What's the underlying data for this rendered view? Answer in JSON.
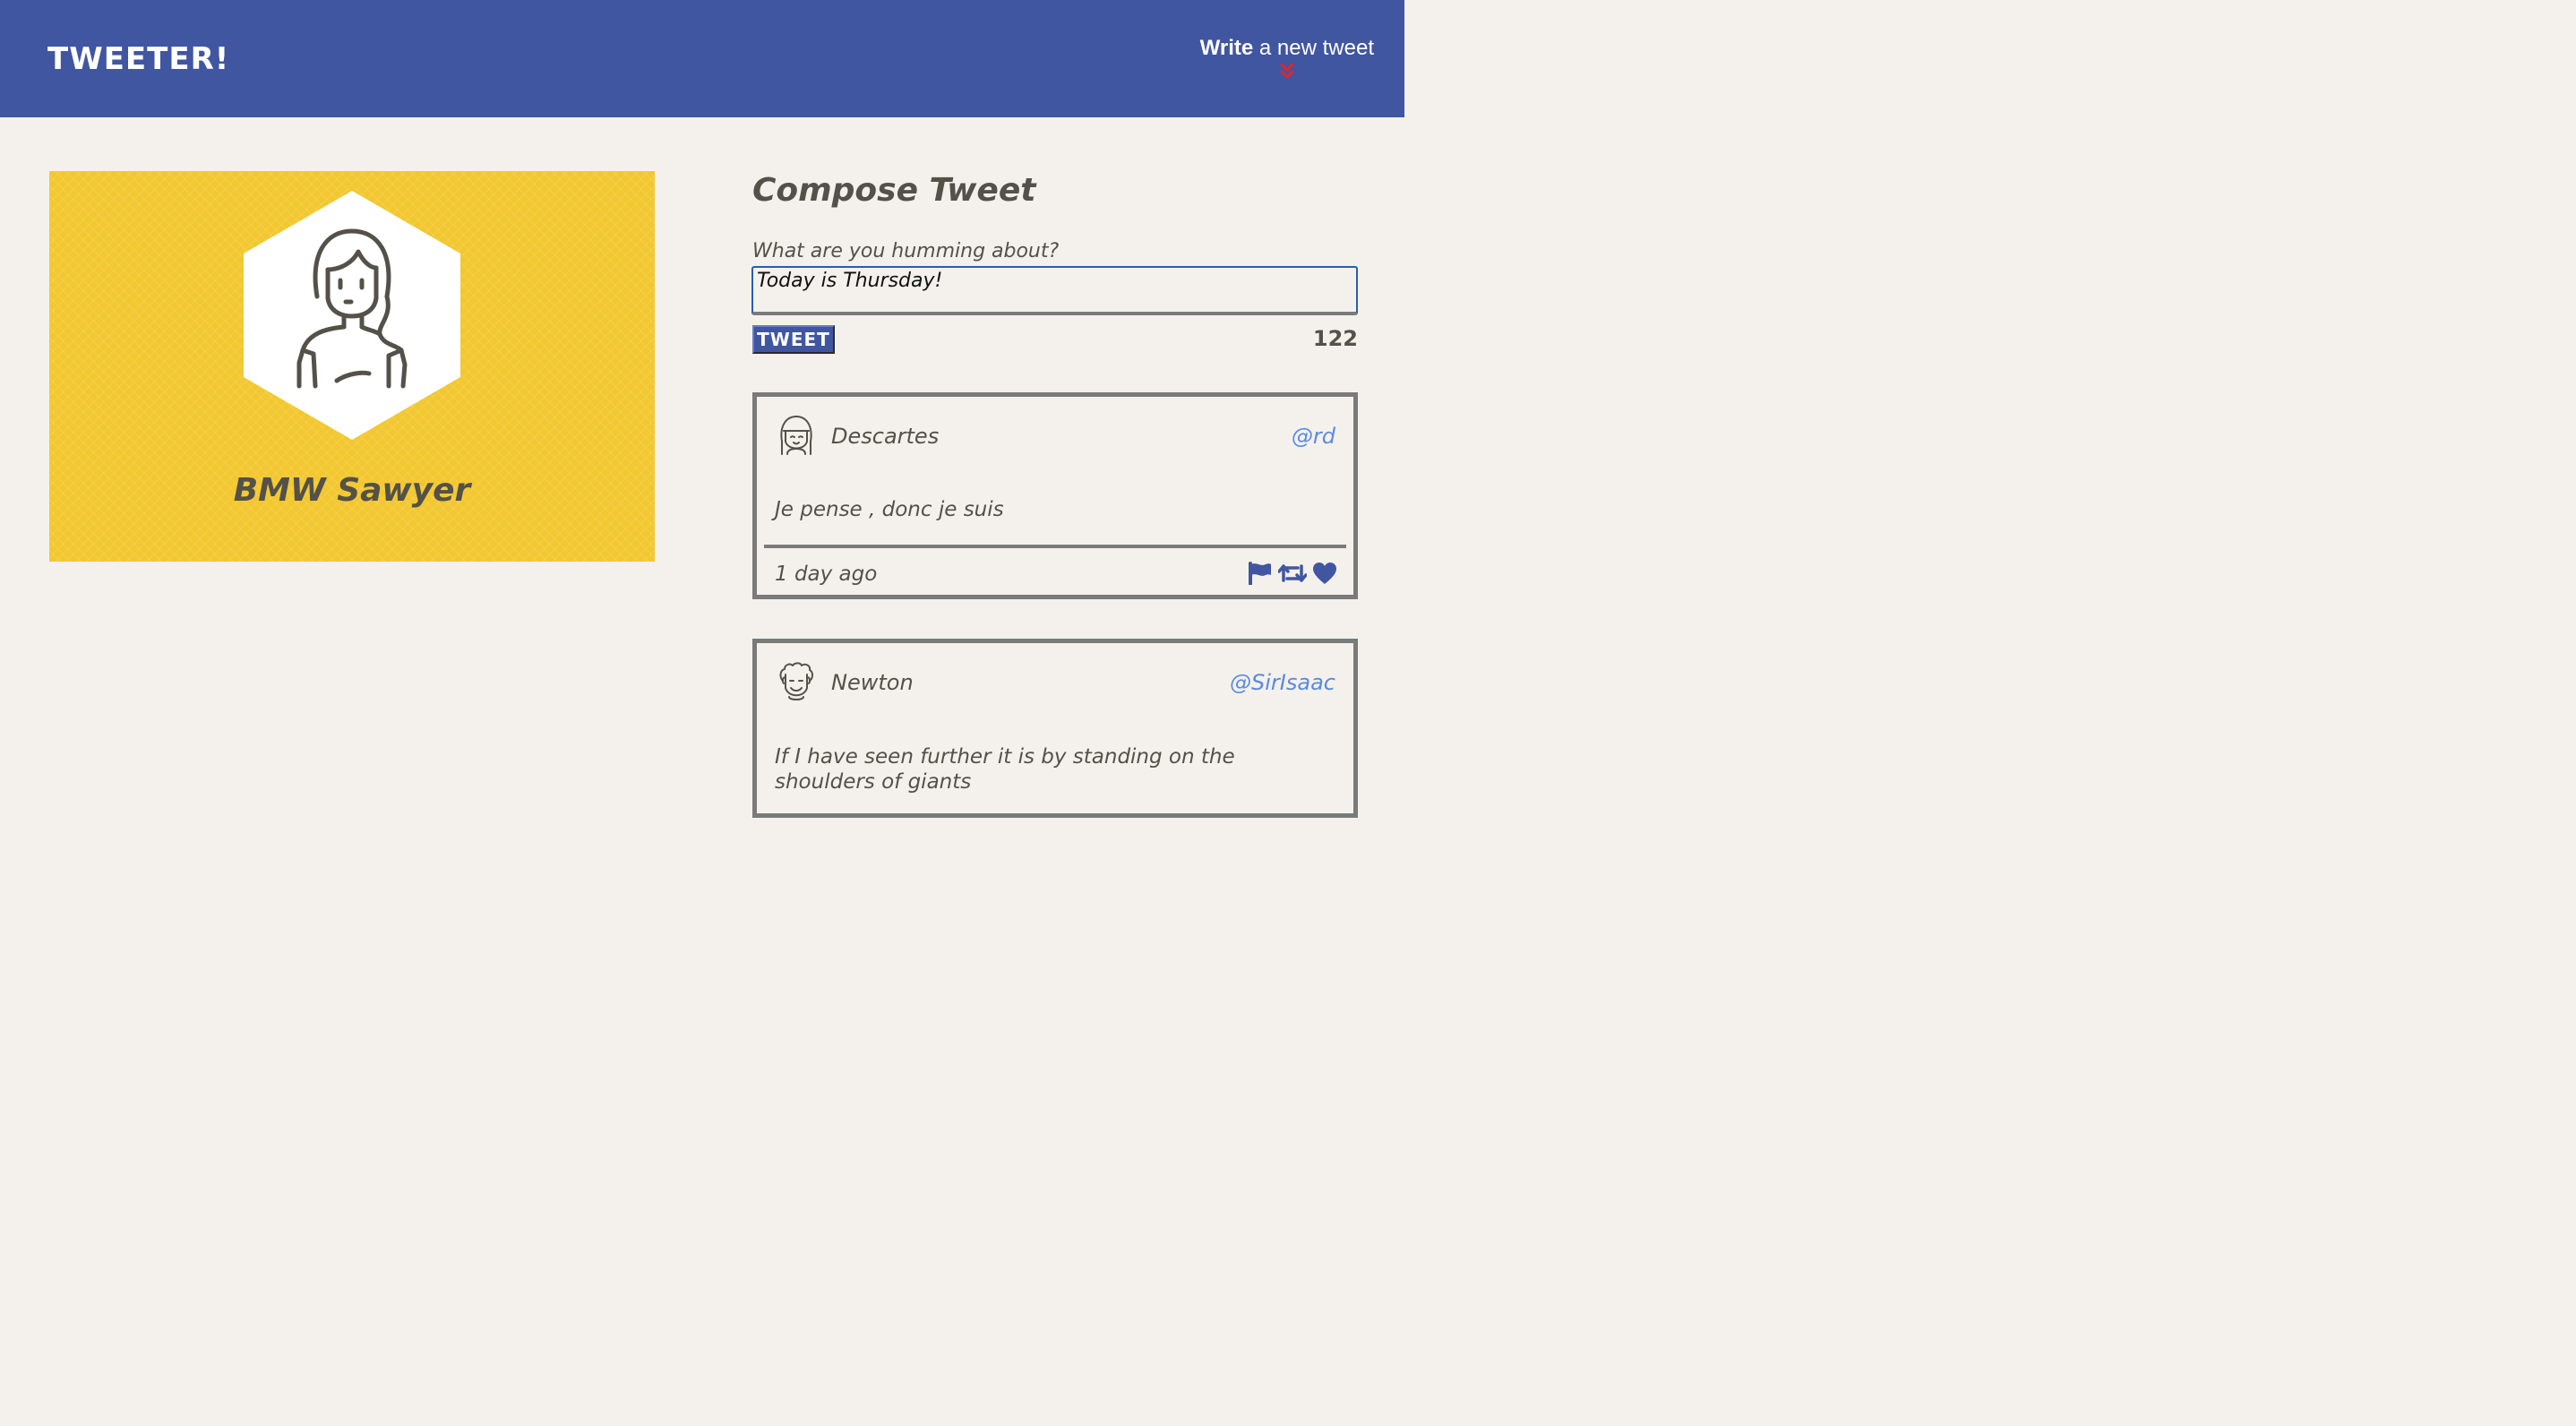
{
  "nav": {
    "brand": "TWEETER!",
    "compose_bold": "Write",
    "compose_rest": " a new tweet",
    "arrow_icon": "double-chevron-down-icon",
    "bg_color": "#4056a1",
    "arrow_color": "#e3242b"
  },
  "profile": {
    "name": "BMW Sawyer",
    "avatar_icon": "woman-avatar-icon",
    "bg_color": "#f2c72f"
  },
  "compose": {
    "title": "Compose Tweet",
    "label": "What are you humming about?",
    "value": "Today is Thursday!",
    "button_label": "TWEET",
    "counter": "122"
  },
  "tweets": [
    {
      "name": "Descartes",
      "handle": "@rd",
      "content": "Je pense , donc je suis",
      "time": "1 day ago",
      "avatar_icon": "girl-avatar-icon",
      "actions": [
        "flag-icon",
        "retweet-icon",
        "heart-icon"
      ]
    },
    {
      "name": "Newton",
      "handle": "@SirIsaac",
      "content": "If I have seen further it is by standing on the shoulders of giants",
      "avatar_icon": "curly-hair-avatar-icon"
    }
  ],
  "colors": {
    "page_bg": "#f4f1ec",
    "text": "#545149",
    "handle": "#5a8ae0",
    "border": "#7a7a7a",
    "action_icons": "#4056a1"
  }
}
